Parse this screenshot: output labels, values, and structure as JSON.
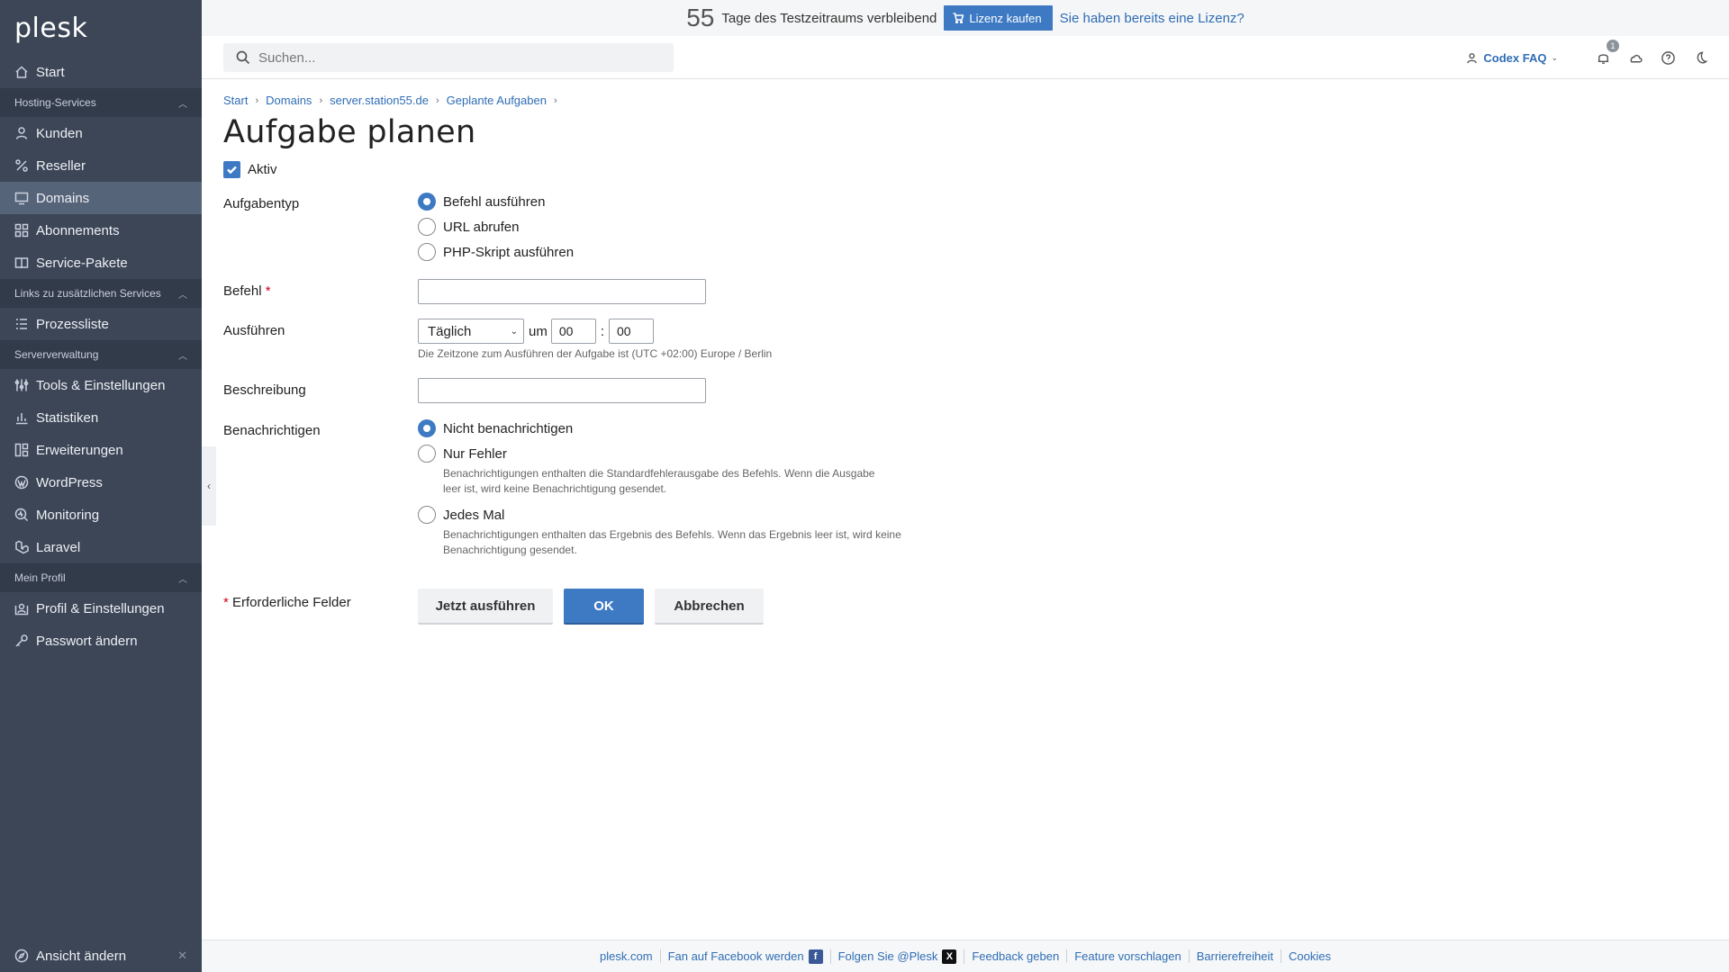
{
  "sidebar": {
    "logo": "plesk",
    "start": "Start",
    "groups": {
      "hosting": "Hosting-Services",
      "links": "Links zu zusätzlichen Services",
      "server": "Serververwaltung",
      "profile": "Mein Profil"
    },
    "items": {
      "kunden": "Kunden",
      "reseller": "Reseller",
      "domains": "Domains",
      "abonnements": "Abonnements",
      "service_pakete": "Service-Pakete",
      "prozessliste": "Prozessliste",
      "tools": "Tools & Einstellungen",
      "statistiken": "Statistiken",
      "erweiterungen": "Erweiterungen",
      "wordpress": "WordPress",
      "monitoring": "Monitoring",
      "laravel": "Laravel",
      "profil": "Profil & Einstellungen",
      "passwort": "Passwort ändern"
    },
    "view_switch": "Ansicht ändern"
  },
  "trial": {
    "days": "55",
    "text": "Tage des Testzeitraums verbleibend",
    "buy_label": "Lizenz kaufen",
    "have_license": "Sie haben bereits eine Lizenz?"
  },
  "header": {
    "search_placeholder": "Suchen...",
    "user": "Codex FAQ",
    "notifications_count": "1"
  },
  "breadcrumb": [
    "Start",
    "Domains",
    "server.station55.de",
    "Geplante Aufgaben"
  ],
  "page": {
    "title": "Aufgabe planen",
    "active_label": "Aktiv",
    "task_type_label": "Aufgabentyp",
    "task_types": [
      "Befehl ausführen",
      "URL abrufen",
      "PHP-Skript ausführen"
    ],
    "command_label": "Befehl",
    "run_label": "Ausführen",
    "frequency": "Täglich",
    "at_label": "um",
    "hour": "00",
    "minute": "00",
    "time_sep": ":",
    "timezone_hint": "Die Zeitzone zum Ausführen der Aufgabe ist (UTC +02:00) Europe / Berlin",
    "description_label": "Beschreibung",
    "notify_label": "Benachrichtigen",
    "notify_options": [
      "Nicht benachrichtigen",
      "Nur Fehler",
      "Jedes Mal"
    ],
    "notify_hint_errors": "Benachrichtigungen enthalten die Standardfehlerausgabe des Befehls. Wenn die Ausgabe leer ist, wird keine Benachrichtigung gesendet.",
    "notify_hint_always": "Benachrichtigungen enthalten das Ergebnis des Befehls. Wenn das Ergebnis leer ist, wird keine Benachrichtigung gesendet.",
    "required_marker": "*",
    "required_fields": "Erforderliche Felder",
    "btn_run_now": "Jetzt ausführen",
    "btn_ok": "OK",
    "btn_cancel": "Abbrechen"
  },
  "footer": {
    "links": [
      "plesk.com",
      "Fan auf Facebook werden",
      "Folgen Sie @Plesk",
      "Feedback geben",
      "Feature vorschlagen",
      "Barrierefreiheit",
      "Cookies"
    ]
  },
  "colors": {
    "sidebar": "#3c4657",
    "accent": "#3e7ac4",
    "link": "#2f6db5"
  }
}
